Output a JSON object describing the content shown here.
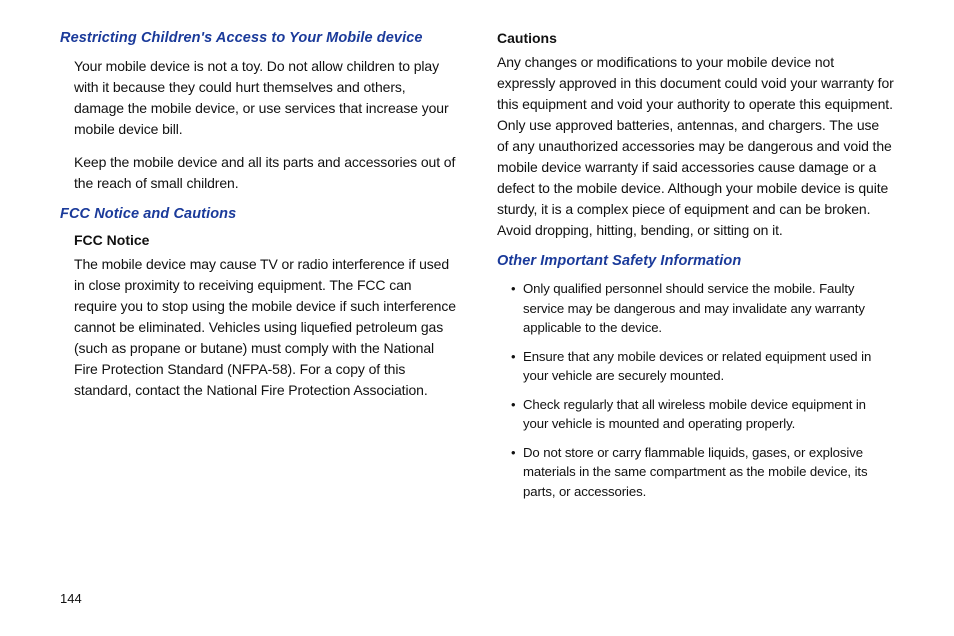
{
  "left": {
    "heading1": "Restricting Children's Access to Your Mobile device",
    "p1": "Your mobile device is not a toy.  Do not allow children to play with it because they could hurt themselves and others, damage the mobile device, or use services that increase your mobile device bill.",
    "p2": "Keep the mobile device and all its parts and accessories out of the reach of small children.",
    "heading2": "FCC Notice and Cautions",
    "sub1": "FCC Notice",
    "p3": "The mobile device may cause TV or radio interference if used in close proximity to receiving equipment.  The FCC can require you to stop using the mobile device if such interference cannot be eliminated.  Vehicles using liquefied petroleum gas (such as propane or butane) must comply with the National Fire Protection Standard (NFPA-58).  For a copy of this standard, contact the National Fire Protection Association."
  },
  "right": {
    "sub1": "Cautions",
    "p1": "Any changes or modifications to your mobile device not expressly approved in this document could void your warranty for this equipment and void your authority to operate this equipment.  Only use approved batteries, antennas, and chargers.  The use of any unauthorized accessories may be dangerous and void the mobile device warranty if said accessories cause damage or a defect to the mobile device.  Although your mobile device is quite sturdy, it is a complex piece of equipment and can be broken.  Avoid dropping, hitting, bending, or sitting on it.",
    "heading1": "Other Important Safety Information",
    "bullets": [
      "Only qualified personnel should service the mobile.  Faulty service may be dangerous and may invalidate any warranty applicable to the device.",
      "Ensure that any mobile devices or related equipment used in your vehicle are securely mounted.",
      "Check regularly that all wireless mobile device equipment in your vehicle is mounted and operating properly.",
      "Do not store or carry flammable liquids, gases, or explosive materials in the same compartment as the mobile device, its parts, or accessories."
    ]
  },
  "pageNumber": "144"
}
